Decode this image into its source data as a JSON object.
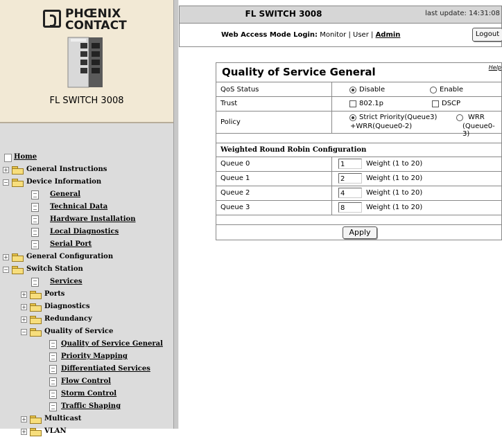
{
  "brand": {
    "logo_line1": "PHŒNIX",
    "logo_line2": "CONTACT",
    "product": "FL SWITCH 3008"
  },
  "header": {
    "title": "FL SWITCH 3008",
    "last_update": "last update: 14:31:08",
    "login_prefix": "Web Access Mode Login:",
    "mode_monitor": "Monitor",
    "mode_user": "User",
    "mode_admin": "Admin",
    "sep": "|",
    "logout_label": "Logout"
  },
  "nav": {
    "home": "Home",
    "items": [
      "General Instructions",
      "Device Information",
      "General",
      "Technical Data",
      "Hardware Installation",
      "Local Diagnostics",
      "Serial Port",
      "General Configuration",
      "Switch Station",
      "Services",
      "Ports",
      "Diagnostics",
      "Redundancy",
      "Quality of Service",
      "Quality of Service General",
      "Priority Mapping",
      "Differentiated Services",
      "Flow Control",
      "Storm Control",
      "Traffic Shaping",
      "Multicast",
      "VLAN"
    ]
  },
  "qos": {
    "title": "Quality of Service General",
    "help": "Help",
    "status": {
      "label": "QoS Status",
      "opt1": "Disable",
      "opt2": "Enable",
      "selected": "Disable"
    },
    "trust": {
      "label": "Trust",
      "opt1": "802.1p",
      "opt2": "DSCP"
    },
    "policy": {
      "label": "Policy",
      "opt1_line1": "Strict Priority(Queue3)",
      "opt1_line2": "+WRR(Queue0-2)",
      "opt2_line1": "WRR",
      "opt2_line2": "(Queue0-3)",
      "selected": "Strict Priority(Queue3) +WRR(Queue0-2)"
    },
    "wrr_header": "Weighted Round Robin Configuration",
    "queues": [
      {
        "label": "Queue 0",
        "weight": "1",
        "hint": "Weight (1 to 20)"
      },
      {
        "label": "Queue 1",
        "weight": "2",
        "hint": "Weight (1 to 20)"
      },
      {
        "label": "Queue 2",
        "weight": "4",
        "hint": "Weight (1 to 20)"
      },
      {
        "label": "Queue 3",
        "weight": "8",
        "hint": "Weight (1 to 20)"
      }
    ],
    "apply_label": "Apply"
  },
  "colors": {
    "brand_bg": "#f2e9d5",
    "nav_bg": "#dcdcdc",
    "header_bg": "#d6d6d6"
  }
}
